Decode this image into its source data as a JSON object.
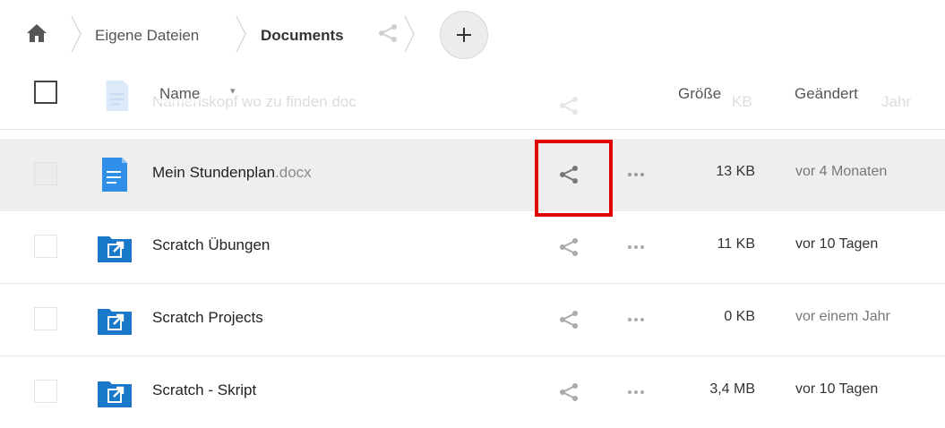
{
  "breadcrumb": {
    "home_icon": "home-icon",
    "items": [
      {
        "label": "Eigene Dateien"
      },
      {
        "label": "Documents"
      }
    ],
    "add_button_label": "+"
  },
  "header": {
    "ghost_name": "Namenskopf wo zu finden doc",
    "ghost_size": "KB",
    "ghost_date": "Jahr",
    "name_label": "Name",
    "sort_indicator": "▾",
    "size_label": "Größe",
    "modified_label": "Geändert"
  },
  "files": [
    {
      "name": "Mein Stundenplan",
      "ext": ".docx",
      "type": "document",
      "size": "13 KB",
      "modified": "vor 4 Monaten",
      "selected": true
    },
    {
      "name": "Scratch Übungen",
      "ext": "",
      "type": "shared-folder",
      "size": "11 KB",
      "modified": "vor 10 Tagen",
      "selected": false
    },
    {
      "name": "Scratch Projects",
      "ext": "",
      "type": "shared-folder",
      "size": "0 KB",
      "modified": "vor einem Jahr",
      "selected": false
    },
    {
      "name": "Scratch - Skript",
      "ext": "",
      "type": "shared-folder",
      "size": "3,4 MB",
      "modified": "vor 10 Tagen",
      "selected": false
    }
  ],
  "colors": {
    "accent_blue": "#1a78c9",
    "doc_blue": "#2f8fe8",
    "highlight_red": "#e00000",
    "selected_row": "#eeeeee"
  }
}
